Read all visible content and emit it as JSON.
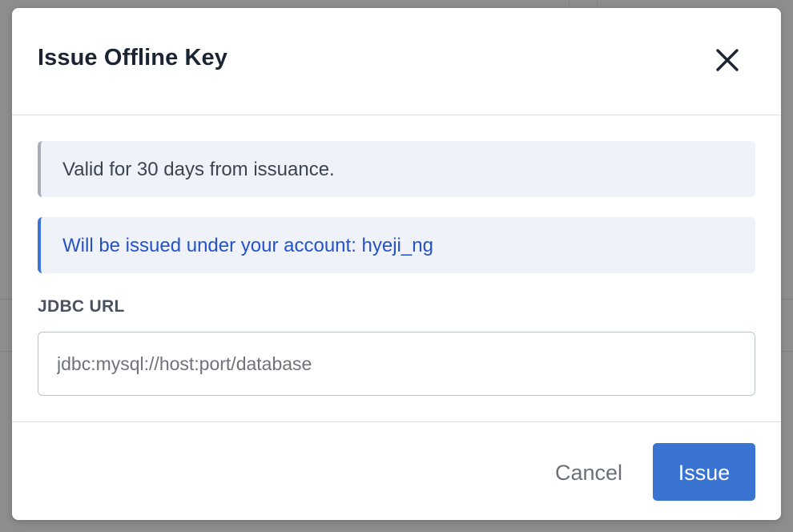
{
  "dialog": {
    "title": "Issue Offline Key",
    "close_icon": "close-icon"
  },
  "callouts": {
    "validity_text": "Valid for 30 days from issuance.",
    "account_text": "Will be issued under your account: hyeji_ng"
  },
  "jdbc": {
    "label": "JDBC URL",
    "value": "",
    "placeholder": "jdbc:mysql://host:port/database"
  },
  "footer": {
    "cancel_label": "Cancel",
    "issue_label": "Issue"
  },
  "colors": {
    "primary": "#3974d2",
    "info_accent": "#3f74d8",
    "info_text": "#2552c7",
    "neutral_accent": "#a6adb8",
    "callout_bg": "#eff3f9",
    "title_text": "#1b2433"
  }
}
